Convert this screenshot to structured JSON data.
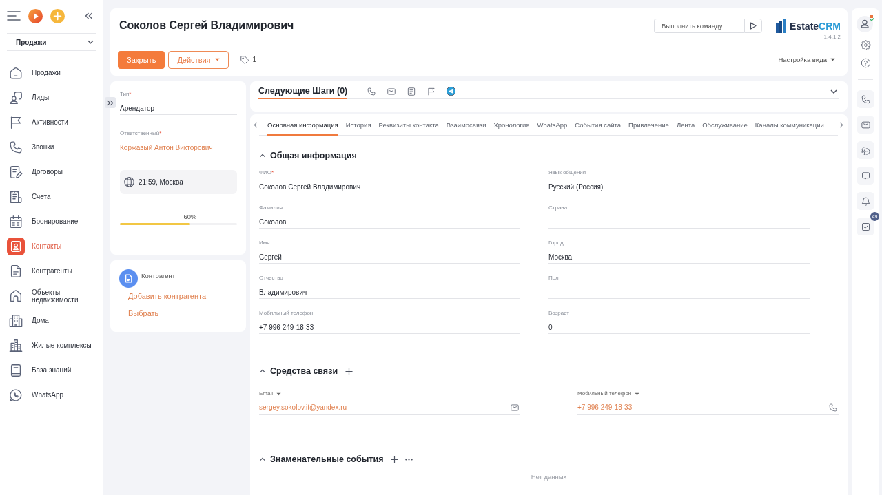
{
  "sidebar": {
    "section_select": {
      "value": "Продажи"
    },
    "items": [
      {
        "label": "Продажи",
        "selected": false
      },
      {
        "label": "Лиды",
        "selected": false
      },
      {
        "label": "Активности",
        "selected": false
      },
      {
        "label": "Звонки",
        "selected": false
      },
      {
        "label": "Договоры",
        "selected": false
      },
      {
        "label": "Счета",
        "selected": false
      },
      {
        "label": "Бронирование",
        "selected": false
      },
      {
        "label": "Контакты",
        "selected": true
      },
      {
        "label": "Контрагенты",
        "selected": false
      },
      {
        "label": "Объекты недвижимости",
        "selected": false
      },
      {
        "label": "Дома",
        "selected": false
      },
      {
        "label": "Жилые комплексы",
        "selected": false
      },
      {
        "label": "База знаний",
        "selected": false
      },
      {
        "label": "WhatsApp",
        "selected": false
      }
    ]
  },
  "header": {
    "title": "Соколов Сергей Владимирович",
    "command": {
      "placeholder": "Выполнить команду"
    },
    "logo": {
      "brand": "Estate",
      "accent": "CRM"
    },
    "version": "1.4.1.2",
    "actions": [
      {
        "label": "Закрыть",
        "kind": "primary"
      },
      {
        "label": "Действия",
        "kind": "dropdown"
      }
    ],
    "tags_count": "1",
    "view_settings": "Настройка вида"
  },
  "summary": {
    "fields": [
      {
        "label": "Тип",
        "mark": "*",
        "value": "Арендатор",
        "kind": "text"
      },
      {
        "label": "Ответственный",
        "mark": "*",
        "value": "Коржавый Антон Викторович",
        "kind": "link"
      }
    ],
    "local_time": "21:59, Москва",
    "progress": {
      "level": 0.6,
      "reading": "60%"
    }
  },
  "counterparty": {
    "title": "Контрагент",
    "links": [
      "Добавить контрагента",
      "Выбрать"
    ]
  },
  "next_steps": {
    "title": "Следующие Шаги (0)"
  },
  "tabs": [
    {
      "label": "Основная информация",
      "selected": true
    },
    {
      "label": "История",
      "selected": false
    },
    {
      "label": "Реквизиты контакта",
      "selected": false
    },
    {
      "label": "Взаимосвязи",
      "selected": false
    },
    {
      "label": "Хронология",
      "selected": false
    },
    {
      "label": "WhatsApp",
      "selected": false
    },
    {
      "label": "События сайта",
      "selected": false
    },
    {
      "label": "Привлечение",
      "selected": false
    },
    {
      "label": "Лента",
      "selected": false
    },
    {
      "label": "Обслуживание",
      "selected": false
    },
    {
      "label": "Каналы коммуникации",
      "selected": false
    }
  ],
  "sections": [
    {
      "kind": "fields",
      "title": "Общая информация",
      "expanded": true,
      "fields": [
        {
          "label": "ФИО",
          "mark": "*",
          "value": "Соколов Сергей Владимирович"
        },
        {
          "label": "Язык общения",
          "value": "Русский (Россия)"
        },
        {
          "label": "Фамилия",
          "value": "Соколов"
        },
        {
          "label": "Страна"
        },
        {
          "label": "Имя",
          "value": "Сергей"
        },
        {
          "label": "Город",
          "value": "Москва"
        },
        {
          "label": "Отчество",
          "value": "Владимирович"
        },
        {
          "label": "Пол"
        },
        {
          "label": "Мобильный телефон",
          "value": "+7 996 249-18-33"
        },
        {
          "label": "Возраст",
          "value": "0"
        }
      ]
    },
    {
      "kind": "contacts",
      "title": "Средства связи",
      "expanded": true,
      "contacts": [
        {
          "label": "Email",
          "value": "sergey.sokolov.it@yandex.ru",
          "kind": "email"
        },
        {
          "label": "Мобильный телефон",
          "value": "+7 996 249-18-33",
          "kind": "phone"
        }
      ]
    },
    {
      "kind": "events",
      "title": "Знаменательные события",
      "expanded": true,
      "empty_text": "Нет данных"
    }
  ],
  "right_bar": {
    "tasks_badge": "49"
  }
}
